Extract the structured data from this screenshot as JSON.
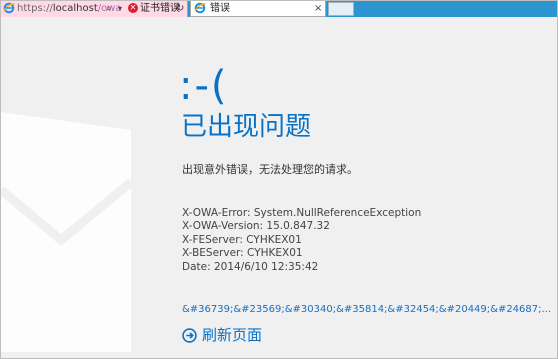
{
  "browser": {
    "address_protocol": "https://",
    "address_host": "localhost",
    "address_path": "/owa",
    "certificate_error_label": "证书错误",
    "tab_title": "错误",
    "tab_close": "×",
    "search_glyph": "⌕",
    "dropdown_glyph": "▾",
    "refresh_glyph": "↻",
    "error_glyph": "✕"
  },
  "error_page": {
    "face": ":-(",
    "title": "已出现问题",
    "message": "出现意外错误，无法处理您的请求。",
    "diagnostics": [
      "X-OWA-Error: System.NullReferenceException",
      "X-OWA-Version: 15.0.847.32",
      "X-FEServer: CYHKEX01",
      "X-BEServer: CYHKEX01",
      "Date: 2014/6/10 12:35:42"
    ],
    "encoded_text": "&#36739;&#23569;&#30340;&#35814;&#32454;&#20449;&#24687;...",
    "refresh_label": "刷新页面"
  },
  "colors": {
    "accent": "#0a72c6",
    "topbar": "#2c95cf",
    "address_error_bg": "#ffd9e6",
    "cert_error": "#d8222b"
  }
}
